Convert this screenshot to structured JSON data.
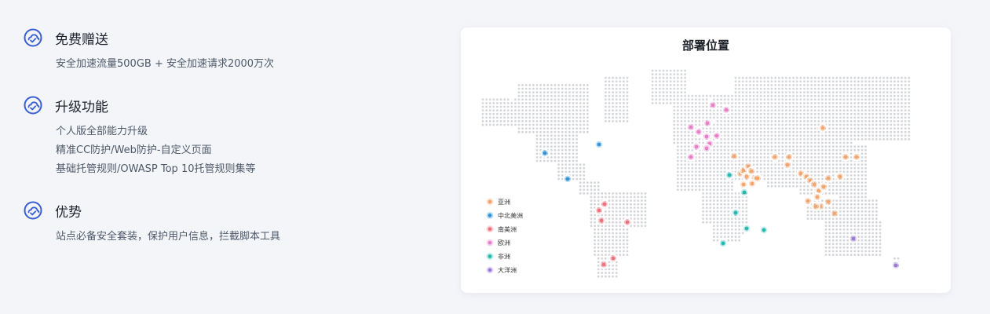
{
  "features": [
    {
      "title": "免费赠送",
      "icon": "cloud-shield-icon",
      "lines": [
        "安全加速流量500GB + 安全加速请求2000万次"
      ]
    },
    {
      "title": "升级功能",
      "icon": "cloud-shield-icon",
      "lines": [
        "个人版全部能力升级",
        "精准CC防护/Web防护-自定义页面",
        "基础托管规则/OWASP Top 10托管规则集等"
      ]
    },
    {
      "title": "优势",
      "icon": "cloud-shield-icon",
      "lines": [
        "站点必备安全套装，保护用户信息，拦截脚本工具"
      ]
    }
  ],
  "map_card": {
    "title": "部署位置",
    "legend": [
      {
        "label": "亚洲",
        "color": "#f5a46b"
      },
      {
        "label": "中北美洲",
        "color": "#2f95d8"
      },
      {
        "label": "南美洲",
        "color": "#ef6f7a"
      },
      {
        "label": "欧洲",
        "color": "#e97fc9"
      },
      {
        "label": "非洲",
        "color": "#23b8b0"
      },
      {
        "label": "大洋洲",
        "color": "#9c7ad8"
      }
    ]
  },
  "colors": {
    "icon": "#3b5ed1",
    "map_dot": "#d4d6da"
  }
}
